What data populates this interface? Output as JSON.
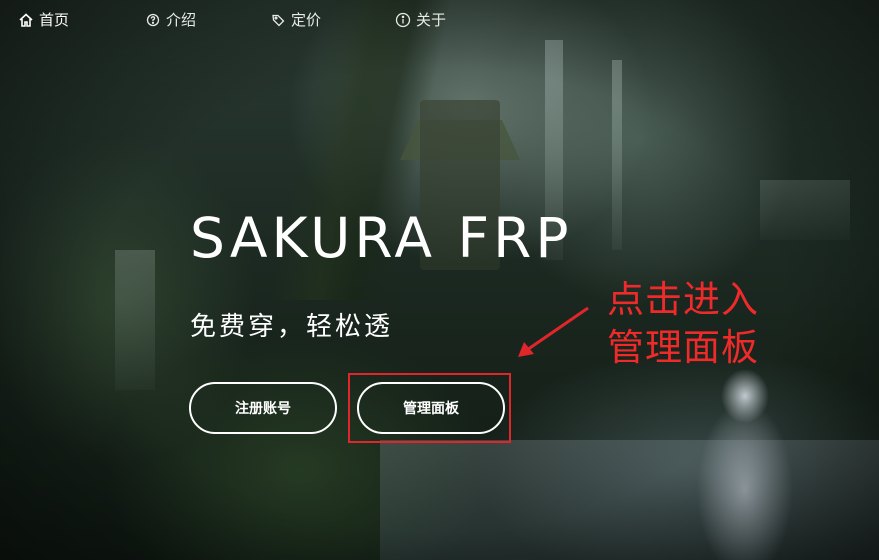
{
  "nav": {
    "items": [
      {
        "label": "首页",
        "icon": "home-icon",
        "active": true
      },
      {
        "label": "介绍",
        "icon": "question-circle-icon",
        "active": false
      },
      {
        "label": "定价",
        "icon": "tag-icon",
        "active": false
      },
      {
        "label": "关于",
        "icon": "info-circle-icon",
        "active": false
      }
    ]
  },
  "hero": {
    "title": "SAKURA FRP",
    "subtitle": "免费穿，轻松透",
    "buttons": {
      "register_label": "注册账号",
      "panel_label": "管理面板"
    }
  },
  "annotation": {
    "line1": "点击进入",
    "line2": "管理面板",
    "color": "#ee2a2a"
  },
  "colors": {
    "text": "#ffffff",
    "highlight": "#e0262b"
  }
}
